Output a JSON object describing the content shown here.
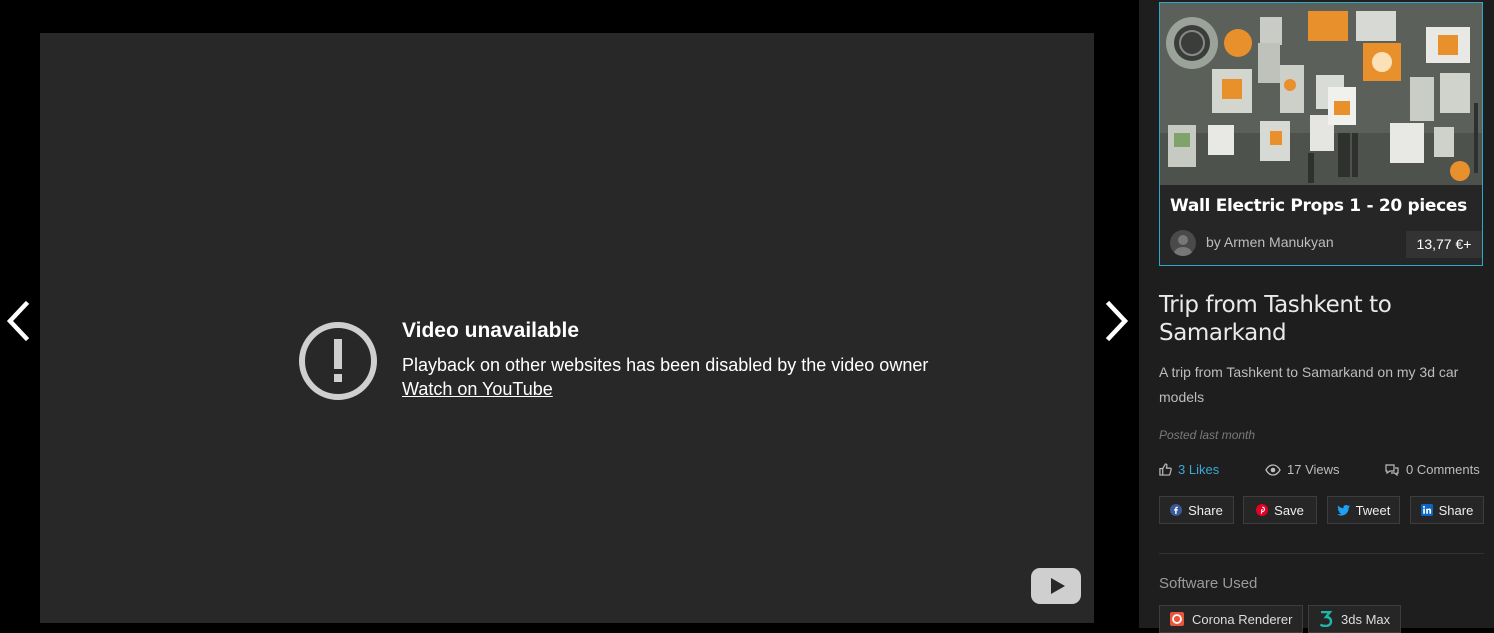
{
  "video": {
    "error_title": "Video unavailable",
    "error_message": "Playback on other websites has been disabled by the video owner",
    "watch_link": "Watch on YouTube"
  },
  "promo": {
    "title": "Wall Electric Props 1 - 20 pieces",
    "author": "by Armen Manukyan",
    "price": "13,77 €+"
  },
  "post": {
    "title": "Trip from Tashkent to Samarkand",
    "description": "A trip from Tashkent to Samarkand on my 3d car models",
    "posted": "Posted last month"
  },
  "stats": {
    "likes": "3 Likes",
    "views": "17 Views",
    "comments": "0 Comments"
  },
  "share": {
    "facebook": "Share",
    "pinterest": "Save",
    "twitter": "Tweet",
    "linkedin": "Share"
  },
  "software": {
    "heading": "Software Used",
    "items": [
      "Corona Renderer",
      "3ds Max"
    ]
  },
  "colors": {
    "accent": "#3aa8d8",
    "promo_border": "#2ea8c9",
    "facebook": "#3b5998",
    "pinterest": "#e60023",
    "twitter": "#1da1f2",
    "linkedin": "#0a66c2",
    "corona": "#e8553a",
    "max": "#1fb5a8"
  }
}
